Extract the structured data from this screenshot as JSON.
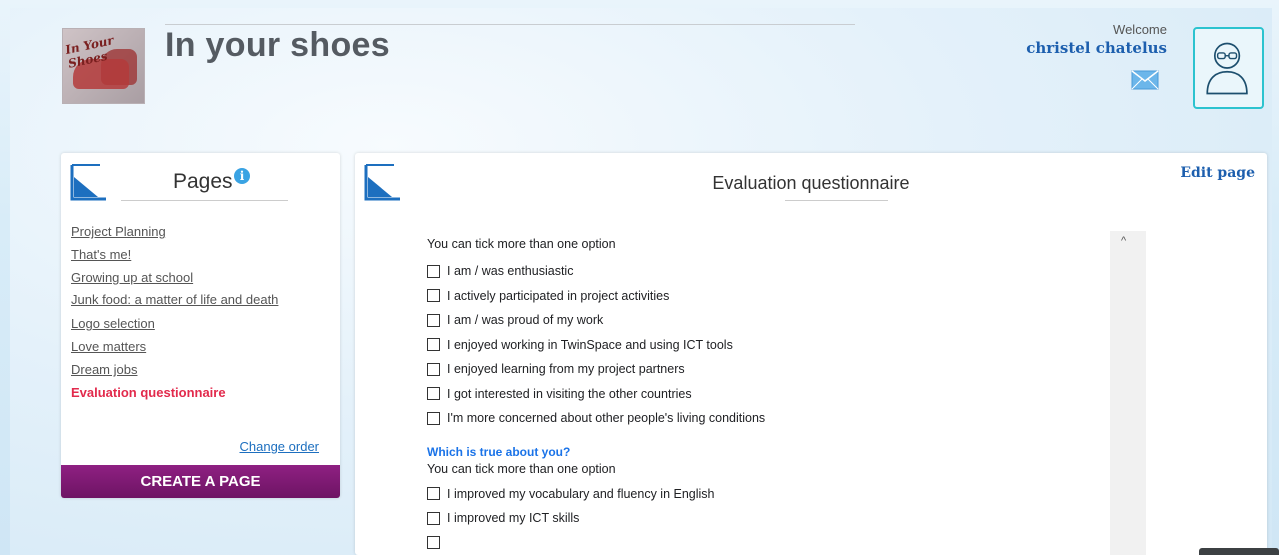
{
  "header": {
    "site_title": "In your shoes",
    "logo_text": "In Your Shoes",
    "welcome": "Welcome",
    "user_name": "christel chatelus"
  },
  "sidebar": {
    "title": "Pages",
    "pages": [
      {
        "label": "Project Planning",
        "active": false
      },
      {
        "label": "That's me!",
        "active": false
      },
      {
        "label": "Growing up at school",
        "active": false
      },
      {
        "label": "Junk food: a matter of life and death",
        "active": false
      },
      {
        "label": "Logo selection",
        "active": false
      },
      {
        "label": "Love matters",
        "active": false
      },
      {
        "label": "Dream jobs",
        "active": false
      },
      {
        "label": "Evaluation questionnaire",
        "active": true
      }
    ],
    "change_order": "Change order",
    "create_page": "CREATE A PAGE"
  },
  "main": {
    "title": "Evaluation questionnaire",
    "edit_page": "Edit page",
    "form": {
      "section1_hint": "You can tick more than one option",
      "section1_options": [
        "I am / was enthusiastic",
        "I actively participated in project activities",
        "I am / was proud of my work",
        "I enjoyed working in TwinSpace and using ICT tools",
        "I enjoyed learning from my project partners",
        "I got interested in visiting the other countries",
        "I'm more concerned about other people's living conditions"
      ],
      "section2_question": "Which is true about you?",
      "section2_hint": "You can tick more than one option",
      "section2_options": [
        "I improved my vocabulary and fluency in English",
        "I improved my ICT skills"
      ]
    }
  },
  "colors": {
    "accent_purple": "#7d1872",
    "active_page": "#e22a4c",
    "link_blue": "#1d5fae",
    "avatar_border": "#2cc3cf"
  },
  "icons": [
    "info-icon",
    "mail-icon",
    "user-avatar-icon",
    "corner-fold-icon",
    "scroll-up-icon"
  ]
}
